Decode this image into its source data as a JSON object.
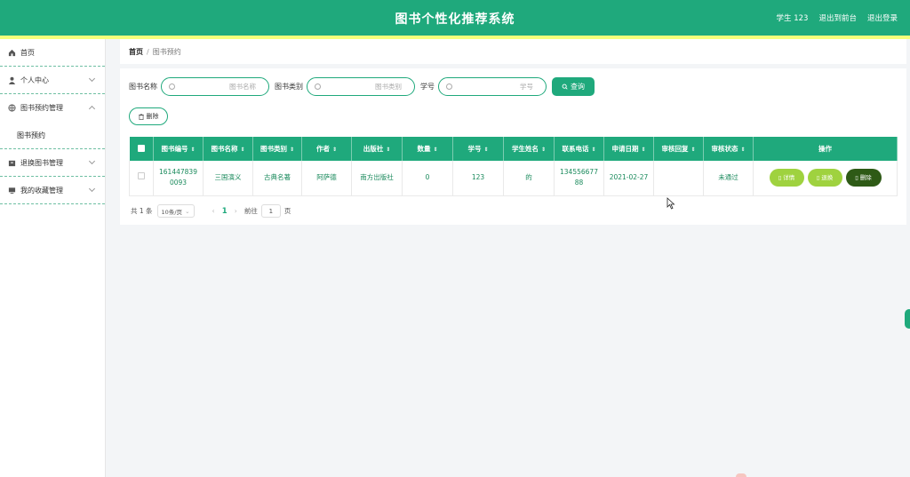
{
  "app": {
    "title": "图书个性化推荐系统"
  },
  "header": {
    "user": "学生 123",
    "front_link": "退出到前台",
    "logout": "退出登录"
  },
  "sidebar": {
    "items": [
      {
        "label": "首页",
        "icon": "home-icon"
      },
      {
        "label": "个人中心",
        "icon": "user-icon"
      },
      {
        "label": "图书预约管理",
        "icon": "globe-icon"
      },
      {
        "label": "图书预约",
        "sub": true
      },
      {
        "label": "退换图书管理",
        "icon": "box-icon"
      },
      {
        "label": "我的收藏管理",
        "icon": "monitor-icon"
      }
    ]
  },
  "breadcrumb": {
    "home": "首页",
    "separator": "/",
    "current": "图书预约"
  },
  "search": {
    "fields": [
      {
        "label": "图书名称",
        "placeholder": "图书名称"
      },
      {
        "label": "图书类别",
        "placeholder": "图书类别"
      },
      {
        "label": "学号",
        "placeholder": "学号"
      }
    ],
    "query_button": "查询"
  },
  "toolbar": {
    "delete_label": "删除"
  },
  "table": {
    "columns": [
      "图书编号",
      "图书名称",
      "图书类别",
      "作者",
      "出版社",
      "数量",
      "学号",
      "学生姓名",
      "联系电话",
      "申请日期",
      "审核回复",
      "审核状态",
      "操作"
    ],
    "rows": [
      [
        "1614478390093",
        "三国演义",
        "古典名著",
        "阿萨德",
        "南方出版社",
        "0",
        "123",
        "的",
        "13455667788",
        "2021-02-27",
        "",
        "未通过"
      ]
    ],
    "actions": {
      "detail": "详情",
      "return": "退换",
      "delete": "删除"
    }
  },
  "pager": {
    "total": "共 1 条",
    "page_size": "10条/页",
    "current_page": "1",
    "goto_label": "前往",
    "goto_value": "1",
    "page_unit": "页"
  },
  "colors": {
    "primary": "#1fa97c",
    "accent_line": "#f5ff7b",
    "action_light": "#9fd23f",
    "action_dark": "#2e5a16"
  }
}
